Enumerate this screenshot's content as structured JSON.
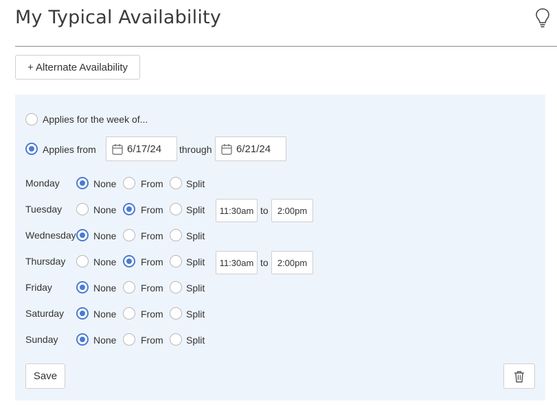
{
  "page": {
    "title": "My Typical Availability"
  },
  "actions": {
    "alternate_label": "+ Alternate Availability",
    "save_label": "Save"
  },
  "range": {
    "week_label": "Applies for the week of...",
    "from_label": "Applies from",
    "through_label": "through",
    "start_date": "6/17/24",
    "end_date": "6/21/24",
    "selected": "from"
  },
  "options": {
    "none": "None",
    "from": "From",
    "split": "Split",
    "to": "to"
  },
  "days": [
    {
      "name": "Monday",
      "mode": "none"
    },
    {
      "name": "Tuesday",
      "mode": "from",
      "start": "11:30am",
      "end": "2:00pm"
    },
    {
      "name": "Wednesday",
      "mode": "none"
    },
    {
      "name": "Thursday",
      "mode": "from",
      "start": "11:30am",
      "end": "2:00pm"
    },
    {
      "name": "Friday",
      "mode": "none"
    },
    {
      "name": "Saturday",
      "mode": "none"
    },
    {
      "name": "Sunday",
      "mode": "none"
    }
  ],
  "colors": {
    "accent": "#4a7bd3",
    "panel": "#eef4fb"
  }
}
